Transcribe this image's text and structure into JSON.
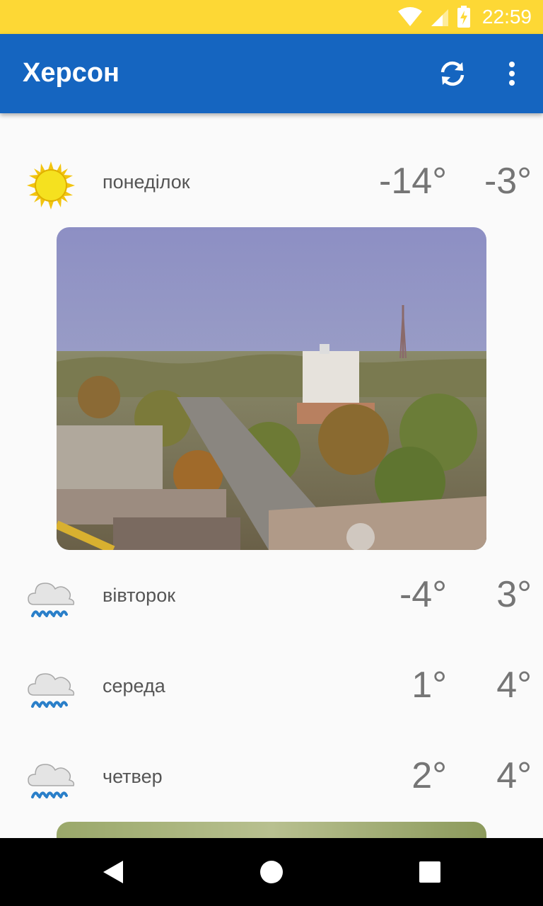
{
  "status": {
    "time": "22:59",
    "bar_color": "#fdd835"
  },
  "app_bar": {
    "title": "Херсон",
    "color": "#1565c0",
    "icons": [
      "refresh-icon",
      "more-vert-icon"
    ]
  },
  "forecast": [
    {
      "day": "понеділок",
      "min": "-14°",
      "max": "-3°",
      "icon": "sun-icon"
    },
    {
      "day": "вівторок",
      "min": "-4°",
      "max": "3°",
      "icon": "rain-cloud-icon"
    },
    {
      "day": "середа",
      "min": "1°",
      "max": "4°",
      "icon": "rain-cloud-icon"
    },
    {
      "day": "четвер",
      "min": "2°",
      "max": "4°",
      "icon": "rain-cloud-icon"
    }
  ],
  "nav": {
    "icons": [
      "back-icon",
      "home-icon",
      "recents-icon"
    ]
  }
}
